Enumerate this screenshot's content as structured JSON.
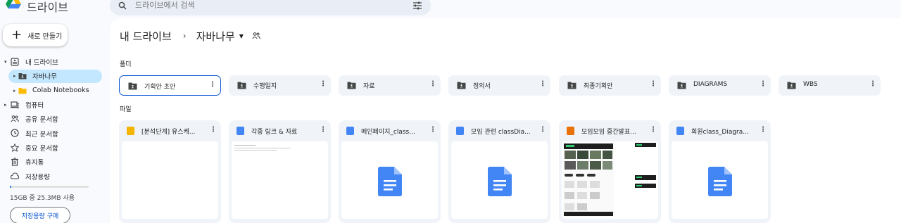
{
  "app": {
    "title": "드라이브"
  },
  "search": {
    "placeholder": "드라이브에서 검색"
  },
  "new_button": {
    "label": "새로 만들기"
  },
  "sidebar": {
    "items": [
      {
        "label": "내 드라이브",
        "icon": "my-drive-icon",
        "caret": "▾"
      },
      {
        "label": "자바나무",
        "icon": "shared-folder-icon",
        "caret": "▸",
        "selected": true
      },
      {
        "label": "Colab Notebooks",
        "icon": "folder-icon",
        "caret": "▸"
      },
      {
        "label": "컴퓨터",
        "icon": "computer-icon",
        "caret": "▸"
      },
      {
        "label": "공유 문서함",
        "icon": "people-icon"
      },
      {
        "label": "최근 문서함",
        "icon": "clock-icon"
      },
      {
        "label": "중요 문서함",
        "icon": "star-icon"
      },
      {
        "label": "휴지통",
        "icon": "trash-icon"
      },
      {
        "label": "저장용량",
        "icon": "cloud-icon"
      }
    ],
    "storage": {
      "text": "15GB 중 25.3MB 사용",
      "used_fraction": 0.0017
    },
    "buy_storage_label": "저장용량 구매"
  },
  "breadcrumb": {
    "root": "내 드라이브",
    "separator": "›",
    "current": "자바나무"
  },
  "sections": {
    "folders": "폴더",
    "files": "파일"
  },
  "folders": [
    {
      "name": "기획안 초안",
      "selected": true
    },
    {
      "name": "수행일지"
    },
    {
      "name": "자료"
    },
    {
      "name": "정의서"
    },
    {
      "name": "최종기획안"
    },
    {
      "name": "DIAGRAMS"
    },
    {
      "name": "WBS"
    }
  ],
  "files": [
    {
      "name": "[분석단계] 유스케...",
      "type": "slides",
      "color": "#f4b400"
    },
    {
      "name": "각종 링크 & 자료",
      "type": "docs",
      "color": "#4285f4"
    },
    {
      "name": "메인페이지_class...",
      "type": "docs",
      "color": "#4285f4"
    },
    {
      "name": "모임 관련 classDia...",
      "type": "docs",
      "color": "#4285f4"
    },
    {
      "name": "모임모임 중간발표...",
      "type": "slides-pptx",
      "color": "#e8710a"
    },
    {
      "name": "회원class_Diagra...",
      "type": "docs",
      "color": "#4285f4"
    }
  ],
  "colors": {
    "accent": "#0b57d0",
    "selected_bg": "#c2e7ff",
    "docs_blue": "#4285f4"
  },
  "more_glyph": "⋮",
  "plus_glyph": "+"
}
